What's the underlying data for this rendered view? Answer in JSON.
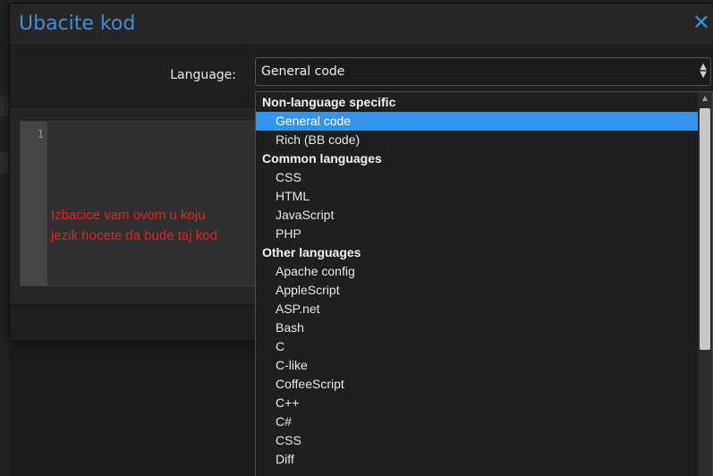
{
  "dialog": {
    "title": "Ubacite kod",
    "close_symbol": "✕"
  },
  "form": {
    "language_label": "Language:",
    "selected_value": "General code"
  },
  "editor": {
    "line_number": "1"
  },
  "annotation": {
    "line1": "Izbacice vam ovom u koju",
    "line2": "jezik hocete da bude taj kod",
    "color": "#e0242a"
  },
  "dropdown": {
    "items": [
      {
        "type": "group",
        "label": "Non-language specific"
      },
      {
        "type": "option",
        "label": "General code",
        "selected": true
      },
      {
        "type": "option",
        "label": "Rich (BB code)"
      },
      {
        "type": "group",
        "label": "Common languages"
      },
      {
        "type": "option",
        "label": "CSS"
      },
      {
        "type": "option",
        "label": "HTML"
      },
      {
        "type": "option",
        "label": "JavaScript"
      },
      {
        "type": "option",
        "label": "PHP"
      },
      {
        "type": "group",
        "label": "Other languages"
      },
      {
        "type": "option",
        "label": "Apache config"
      },
      {
        "type": "option",
        "label": "AppleScript"
      },
      {
        "type": "option",
        "label": "ASP.net"
      },
      {
        "type": "option",
        "label": "Bash"
      },
      {
        "type": "option",
        "label": "C"
      },
      {
        "type": "option",
        "label": "C-like"
      },
      {
        "type": "option",
        "label": "CoffeeScript"
      },
      {
        "type": "option",
        "label": "C++"
      },
      {
        "type": "option",
        "label": "C#"
      },
      {
        "type": "option",
        "label": "CSS"
      },
      {
        "type": "option",
        "label": "Diff"
      }
    ]
  },
  "colors": {
    "accent": "#3d8fd1",
    "selection": "#3394ea"
  }
}
